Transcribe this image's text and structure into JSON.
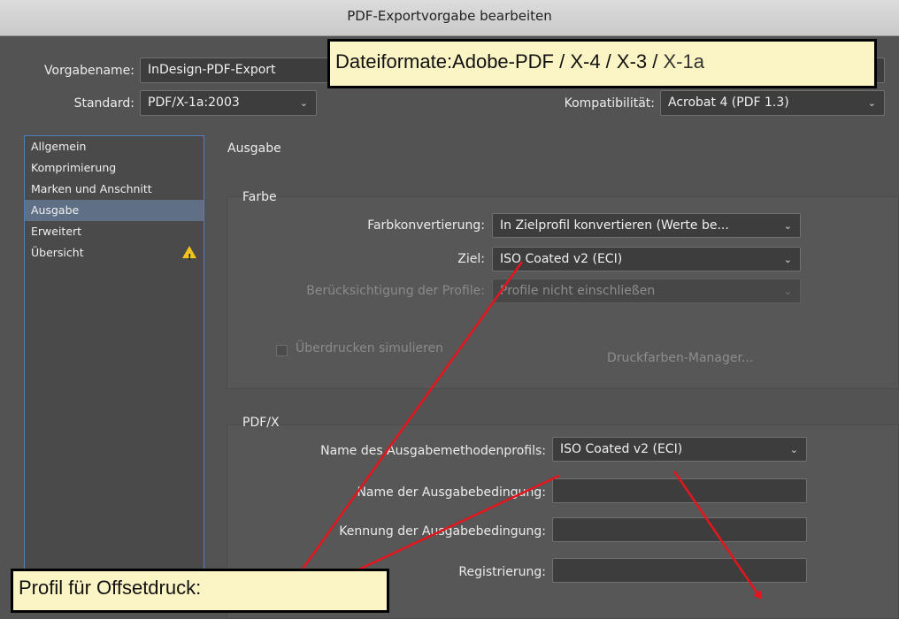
{
  "window": {
    "title": "PDF-Exportvorgabe bearbeiten"
  },
  "preset": {
    "name_label": "Vorgabename:",
    "name_value": "InDesign-PDF-Export",
    "standard_label": "Standard:",
    "standard_value": "PDF/X-1a:2003",
    "compat_label": "Kompatibilität:",
    "compat_value": "Acrobat 4 (PDF 1.3)"
  },
  "sidebar": {
    "items": [
      {
        "label": "Allgemein"
      },
      {
        "label": "Komprimierung"
      },
      {
        "label": "Marken und Anschnitt"
      },
      {
        "label": "Ausgabe"
      },
      {
        "label": "Erweitert"
      },
      {
        "label": "Übersicht"
      }
    ],
    "selected": "Ausgabe",
    "warning_glyph": "!"
  },
  "main": {
    "section_title": "Ausgabe",
    "farbe": {
      "title": "Farbe",
      "conversion_label": "Farbkonvertierung:",
      "conversion_value": "In Zielprofil konvertieren (Werte be...",
      "target_label": "Ziel:",
      "target_value": "ISO Coated v2 (ECI)",
      "profiles_label": "Berücksichtigung der Profile:",
      "profiles_value": "Profile nicht einschließen",
      "overprint_label": "Überdrucken simulieren",
      "ink_manager_label": "Druckfarben-Manager..."
    },
    "pdfx": {
      "title": "PDF/X",
      "output_profile_label": "Name des Ausgabemethodenprofils:",
      "output_profile_value": "ISO Coated v2 (ECI)",
      "condition_name_label": "Name der Ausgabebedingung:",
      "condition_name_value": "",
      "condition_id_label": "Kennung der Ausgabebedingung:",
      "condition_id_value": "",
      "registry_label": "Registrierung:",
      "registry_value": ""
    }
  },
  "annotations": {
    "formats_bold": "Dateiformate:Adobe-PDF / X-4 / X-3 /",
    "formats_light": " X-1a",
    "profile_note": "Profil für Offsetdruck:"
  },
  "colors": {
    "background": "#535353",
    "selection": "#5f6f86",
    "callout_fill": "#fbf4c4",
    "arrow": "#e4151d",
    "warning": "#f2c31b"
  }
}
